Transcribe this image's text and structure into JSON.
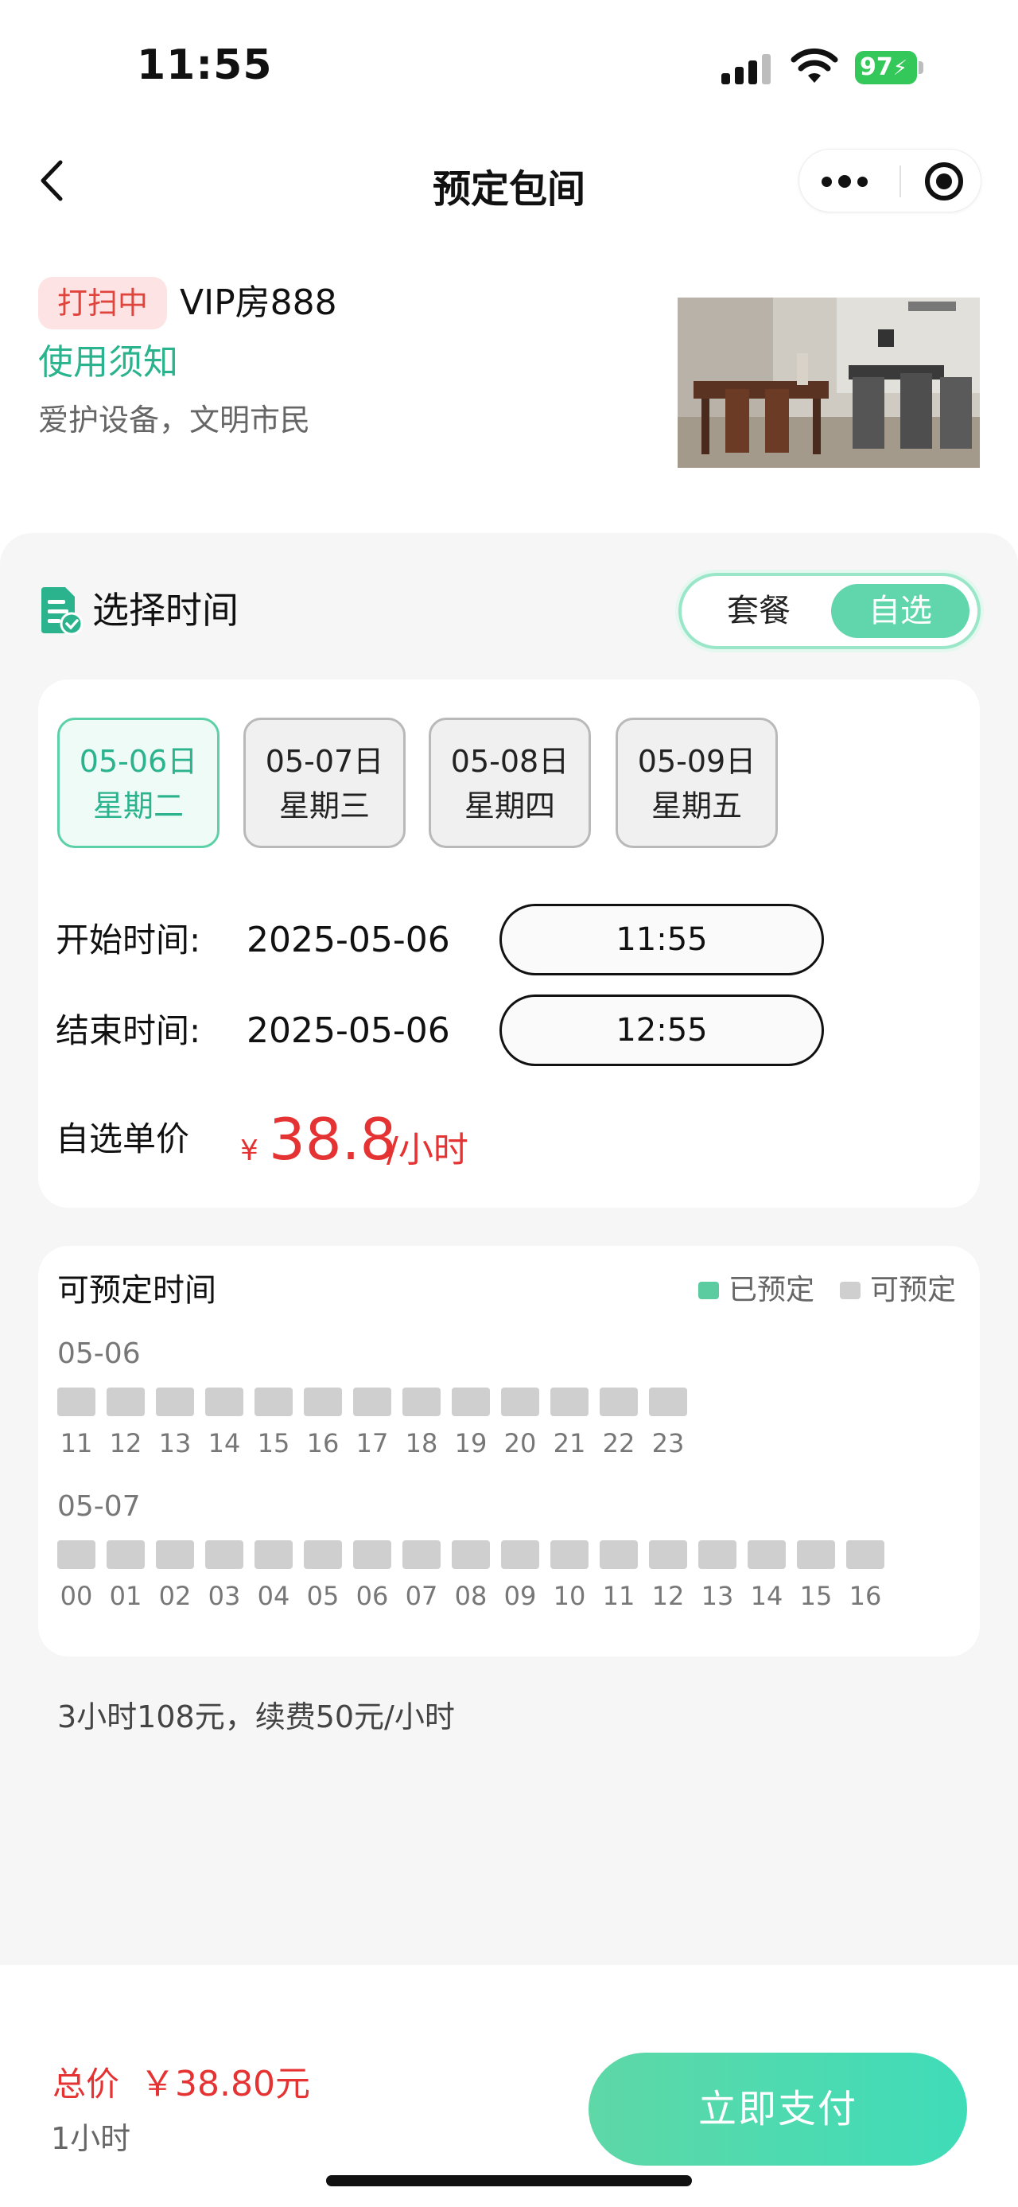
{
  "status_bar": {
    "time": "11:55",
    "battery": "97"
  },
  "nav": {
    "title": "预定包间"
  },
  "room": {
    "status": "打扫中",
    "name": "VIP房888",
    "notice_link": "使用须知",
    "notice_text": "爱护设备，文明市民"
  },
  "section": {
    "title": "选择时间",
    "mode_options": [
      "套餐",
      "自选"
    ],
    "mode_selected": "自选"
  },
  "dates": [
    {
      "date": "05-06日",
      "weekday": "星期二",
      "selected": true
    },
    {
      "date": "05-07日",
      "weekday": "星期三",
      "selected": false
    },
    {
      "date": "05-08日",
      "weekday": "星期四",
      "selected": false
    },
    {
      "date": "05-09日",
      "weekday": "星期五",
      "selected": false
    }
  ],
  "start": {
    "label": "开始时间:",
    "date": "2025-05-06",
    "time": "11:55"
  },
  "end": {
    "label": "结束时间:",
    "date": "2025-05-06",
    "time": "12:55"
  },
  "price": {
    "label": "自选单价",
    "currency": "¥",
    "value": "38.8",
    "unit": "/小时"
  },
  "availability": {
    "title": "可预定时间",
    "legend_booked": "已预定",
    "legend_available": "可预定",
    "days": [
      {
        "date": "05-06",
        "hours": [
          "11",
          "12",
          "13",
          "14",
          "15",
          "16",
          "17",
          "18",
          "19",
          "20",
          "21",
          "22",
          "23"
        ],
        "booked": [
          false,
          false,
          false,
          false,
          false,
          false,
          false,
          false,
          false,
          false,
          false,
          false,
          false
        ]
      },
      {
        "date": "05-07",
        "hours": [
          "00",
          "01",
          "02",
          "03",
          "04",
          "05",
          "06",
          "07",
          "08",
          "09",
          "10",
          "11",
          "12",
          "13",
          "14",
          "15",
          "16"
        ],
        "booked": [
          false,
          false,
          false,
          false,
          false,
          false,
          false,
          false,
          false,
          false,
          false,
          false,
          false,
          false,
          false,
          false,
          false
        ]
      }
    ]
  },
  "note": "3小时108元，续费50元/小时",
  "footer": {
    "total_label": "总价",
    "total_value": "￥38.80元",
    "duration": "1小时",
    "pay_label": "立即支付"
  },
  "colors": {
    "accent": "#2bb38d",
    "price": "#e53232",
    "booked": "#5bcca0",
    "available": "#cfcfcf"
  }
}
